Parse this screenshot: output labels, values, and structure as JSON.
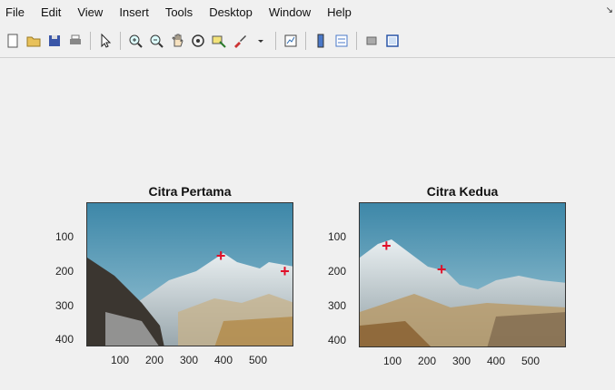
{
  "menu": [
    "File",
    "Edit",
    "View",
    "Insert",
    "Tools",
    "Desktop",
    "Window",
    "Help"
  ],
  "menu_arrow": "↘",
  "toolbar": [
    {
      "name": "new-figure-icon"
    },
    {
      "name": "open-file-icon"
    },
    {
      "name": "save-icon"
    },
    {
      "name": "print-icon"
    },
    {
      "sep": true
    },
    {
      "name": "pointer-icon"
    },
    {
      "sep": true
    },
    {
      "name": "zoom-in-icon"
    },
    {
      "name": "zoom-out-icon"
    },
    {
      "name": "pan-icon"
    },
    {
      "name": "rotate-3d-icon"
    },
    {
      "name": "data-cursor-icon"
    },
    {
      "name": "brush-icon"
    },
    {
      "name": "dropdown-icon"
    },
    {
      "sep": true
    },
    {
      "name": "link-plot-icon"
    },
    {
      "sep": true
    },
    {
      "name": "colorbar-icon"
    },
    {
      "name": "legend-icon"
    },
    {
      "sep": true
    },
    {
      "name": "hide-plot-tools-icon"
    },
    {
      "name": "show-plot-tools-icon"
    }
  ],
  "axes": [
    {
      "title": "Citra Pertama",
      "yticks": [
        "100",
        "200",
        "300",
        "400"
      ],
      "xticks": [
        "100",
        "200",
        "300",
        "400",
        "500"
      ],
      "markers": [
        {
          "x": 390,
          "y": 155
        },
        {
          "x": 575,
          "y": 200
        }
      ]
    },
    {
      "title": "Citra Kedua",
      "yticks": [
        "100",
        "200",
        "300",
        "400"
      ],
      "xticks": [
        "100",
        "200",
        "300",
        "400",
        "500"
      ],
      "markers": [
        {
          "x": 80,
          "y": 125
        },
        {
          "x": 240,
          "y": 195
        }
      ]
    }
  ],
  "colors": {
    "marker": "#e0102a",
    "background": "#f0f0f0"
  }
}
